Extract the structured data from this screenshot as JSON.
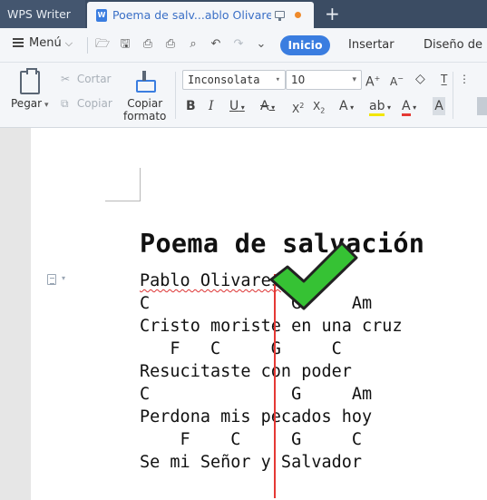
{
  "tabbar": {
    "app_title": "WPS Writer",
    "doc_tab_title": "Poema de salv...ablo Olivares",
    "new_tab": "+"
  },
  "menubar": {
    "menu_label": "Menú",
    "tabs": [
      {
        "label": "Inicio",
        "active": true
      },
      {
        "label": "Insertar",
        "active": false
      },
      {
        "label": "Diseño de p",
        "active": false
      }
    ]
  },
  "ribbon": {
    "paste_label": "Pegar",
    "cut_label": "Cortar",
    "copy_label": "Copiar",
    "format_painter_line1": "Copiar",
    "format_painter_line2": "formato",
    "font_name": "Inconsolata",
    "font_size": "10"
  },
  "document": {
    "title": "Poema de salvación",
    "lines": [
      {
        "text": "Pablo Olivares",
        "kind": "author"
      },
      {
        "text": "C              G     Am",
        "kind": "chords"
      },
      {
        "text": "Cristo moriste en una cruz",
        "kind": "lyric"
      },
      {
        "text": "   F   C     G     C",
        "kind": "chords"
      },
      {
        "text": "Resucitaste con poder",
        "kind": "lyric"
      },
      {
        "text": "C              G     Am",
        "kind": "chords"
      },
      {
        "text": "Perdona mis pecados hoy",
        "kind": "lyric"
      },
      {
        "text": "    F    C     G     C",
        "kind": "chords"
      },
      {
        "text": "Se mi Señor y Salvador",
        "kind": "lyric"
      }
    ]
  },
  "colors": {
    "accent": "#3a7de0",
    "tab_bar": "#3b4c63",
    "check_fill": "#36c234",
    "cursor_line": "#e53935",
    "unsaved_dot": "#ef8a2b"
  }
}
